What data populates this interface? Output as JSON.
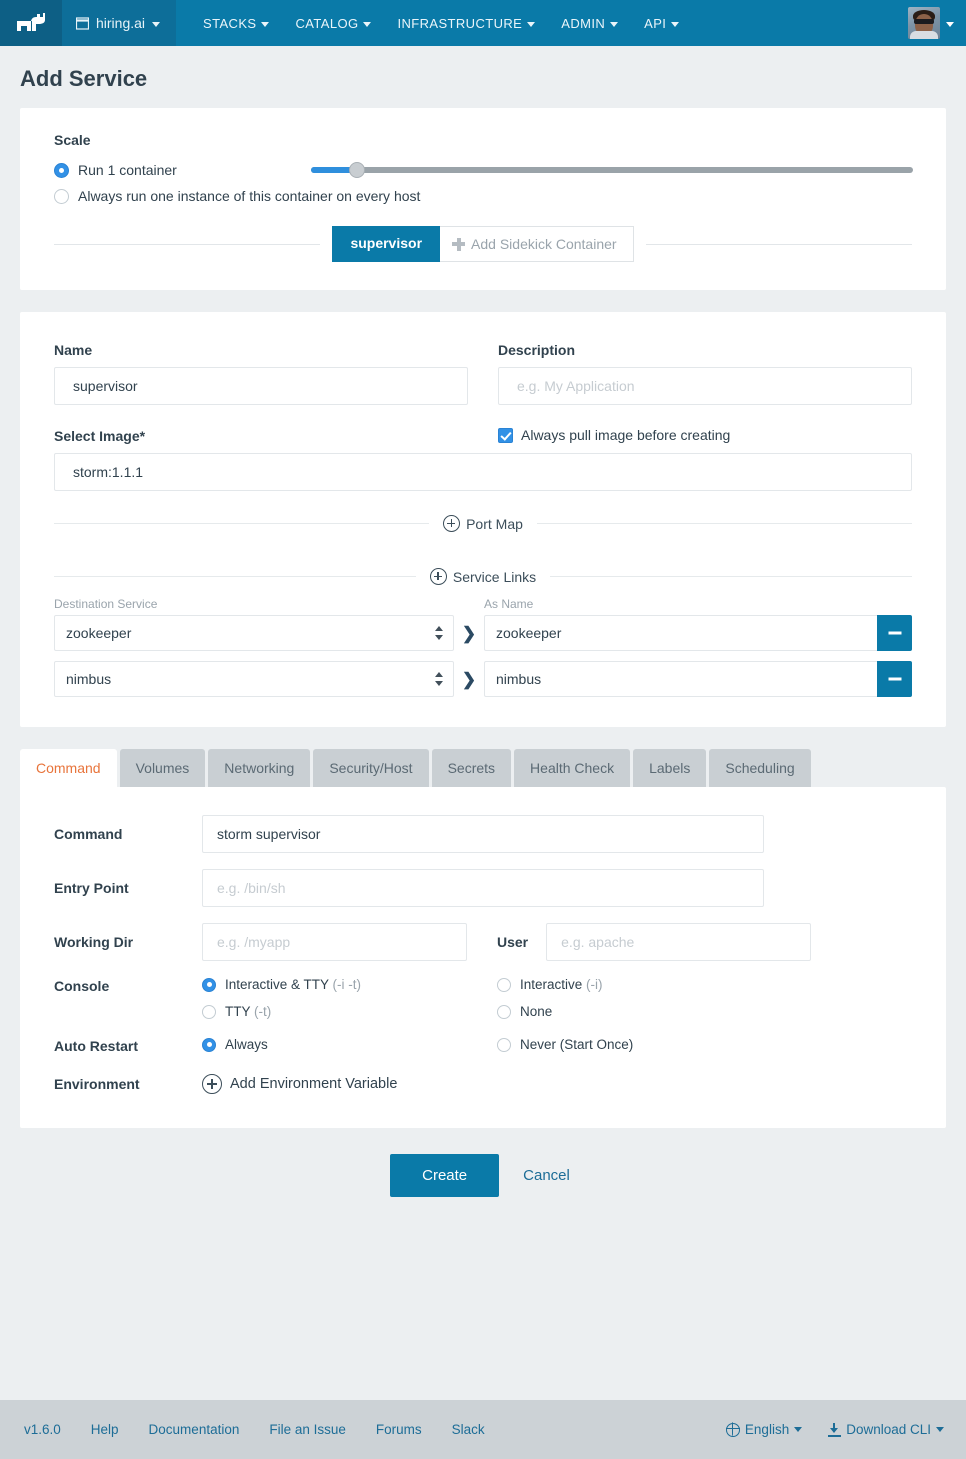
{
  "navbar": {
    "logo_icon": "rancher-cow-logo",
    "environment": {
      "icon": "box-icon",
      "label": "hiring.ai"
    },
    "menu": [
      {
        "label": "STACKS"
      },
      {
        "label": "CATALOG"
      },
      {
        "label": "INFRASTRUCTURE"
      },
      {
        "label": "ADMIN"
      },
      {
        "label": "API"
      }
    ],
    "accent_color": "#0a7aa8",
    "env_color": "#0d6e99"
  },
  "page": {
    "title": "Add Service"
  },
  "scale": {
    "heading": "Scale",
    "option_run_label": "Run 1 container",
    "option_run_selected": true,
    "option_global_label": "Always run one instance of this container on every host",
    "option_global_selected": false,
    "slider_value_percent": 7.6
  },
  "sidekick": {
    "active_tab": "supervisor",
    "add_label": "Add Sidekick Container"
  },
  "service": {
    "name_label": "Name",
    "name_value": "supervisor",
    "description_label": "Description",
    "description_value": "",
    "description_placeholder": "e.g. My Application",
    "image_label": "Select Image*",
    "image_value": "storm:1.1.1",
    "pull_label": "Always pull image before creating",
    "pull_checked": true
  },
  "port_map": {
    "add_label": "Port Map"
  },
  "service_links": {
    "add_label": "Service Links",
    "col_destination": "Destination Service",
    "col_asname": "As Name",
    "rows": [
      {
        "destination": "zookeeper",
        "as_name": "zookeeper"
      },
      {
        "destination": "nimbus",
        "as_name": "nimbus"
      }
    ]
  },
  "tabs": [
    {
      "label": "Command",
      "active": true
    },
    {
      "label": "Volumes",
      "active": false
    },
    {
      "label": "Networking",
      "active": false
    },
    {
      "label": "Security/Host",
      "active": false
    },
    {
      "label": "Secrets",
      "active": false
    },
    {
      "label": "Health Check",
      "active": false
    },
    {
      "label": "Labels",
      "active": false
    },
    {
      "label": "Scheduling",
      "active": false
    }
  ],
  "command_panel": {
    "command_label": "Command",
    "command_value": "storm supervisor",
    "entrypoint_label": "Entry Point",
    "entrypoint_value": "",
    "entrypoint_placeholder": "e.g. /bin/sh",
    "workingdir_label": "Working Dir",
    "workingdir_value": "",
    "workingdir_placeholder": "e.g. /myapp",
    "user_label": "User",
    "user_value": "",
    "user_placeholder": "e.g. apache",
    "console_label": "Console",
    "console_options": [
      {
        "label": "Interactive & TTY ",
        "flag": "(-i -t)",
        "selected": true
      },
      {
        "label": "Interactive ",
        "flag": "(-i)",
        "selected": false
      },
      {
        "label": "TTY ",
        "flag": "(-t)",
        "selected": false
      },
      {
        "label": "None",
        "flag": "",
        "selected": false
      }
    ],
    "autorestart_label": "Auto Restart",
    "autorestart_options": [
      {
        "label": "Always",
        "flag": "",
        "selected": true
      },
      {
        "label": "Never (Start Once)",
        "flag": "",
        "selected": false
      }
    ],
    "environment_label": "Environment",
    "environment_add_label": "Add Environment Variable"
  },
  "actions": {
    "create_label": "Create",
    "cancel_label": "Cancel"
  },
  "footer": {
    "links": [
      {
        "label": "v1.6.0"
      },
      {
        "label": "Help"
      },
      {
        "label": "Documentation"
      },
      {
        "label": "File an Issue"
      },
      {
        "label": "Forums"
      },
      {
        "label": "Slack"
      }
    ],
    "language": "English",
    "download_cli": "Download CLI"
  }
}
